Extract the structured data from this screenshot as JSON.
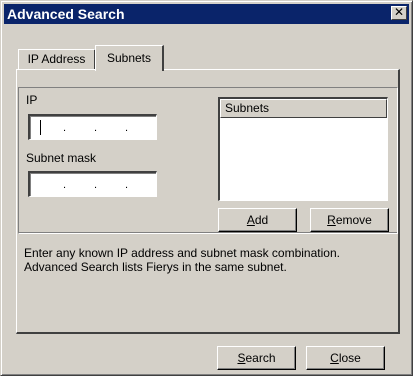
{
  "window": {
    "title": "Advanced Search",
    "close_glyph": "✕"
  },
  "tabs": [
    {
      "label": "IP Address",
      "selected": false
    },
    {
      "label": "Subnets",
      "selected": true
    }
  ],
  "form": {
    "ip_label": "IP",
    "ip_value": ". . .",
    "mask_label": "Subnet mask",
    "mask_value": ". . ."
  },
  "list": {
    "header": "Subnets",
    "items": []
  },
  "buttons": {
    "add": {
      "mnemonic": "A",
      "rest": "dd"
    },
    "remove": {
      "mnemonic": "R",
      "rest": "emove"
    },
    "search": {
      "mnemonic": "S",
      "rest": "earch"
    },
    "close": {
      "mnemonic": "C",
      "rest": "lose"
    }
  },
  "help_text": "Enter any known IP address and subnet mask combination. Advanced Search lists Fierys in the same subnet.",
  "icons": {
    "close": "close-icon"
  },
  "colors": {
    "titlebar": "#0a246a",
    "face": "#d4d0c8"
  }
}
